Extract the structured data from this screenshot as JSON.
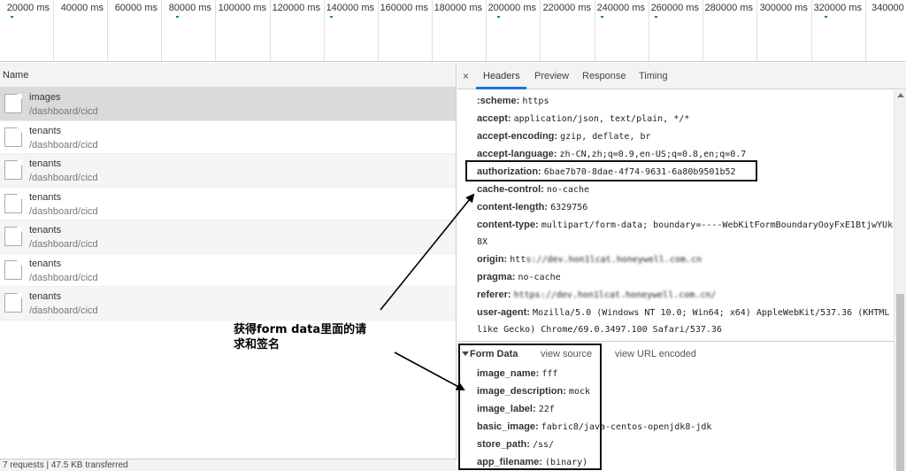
{
  "timeline": {
    "ticks": [
      "20000 ms",
      "40000 ms",
      "60000 ms",
      "80000 ms",
      "100000 ms",
      "120000 ms",
      "140000 ms",
      "160000 ms",
      "180000 ms",
      "200000 ms",
      "220000 ms",
      "240000 ms",
      "260000 ms",
      "280000 ms",
      "300000 ms",
      "320000 ms",
      "340000"
    ]
  },
  "requests": {
    "column_header": "Name",
    "items": [
      {
        "name": "images",
        "path": "/dashboard/cicd"
      },
      {
        "name": "tenants",
        "path": "/dashboard/cicd"
      },
      {
        "name": "tenants",
        "path": "/dashboard/cicd"
      },
      {
        "name": "tenants",
        "path": "/dashboard/cicd"
      },
      {
        "name": "tenants",
        "path": "/dashboard/cicd"
      },
      {
        "name": "tenants",
        "path": "/dashboard/cicd"
      },
      {
        "name": "tenants",
        "path": "/dashboard/cicd"
      }
    ],
    "status": "7 requests | 47.5 KB transferred"
  },
  "tabs": {
    "close": "×",
    "headers": "Headers",
    "preview": "Preview",
    "response": "Response",
    "timing": "Timing"
  },
  "headers": {
    "scheme": {
      "k": ":scheme:",
      "v": "https"
    },
    "accept": {
      "k": "accept:",
      "v": "application/json, text/plain, */*"
    },
    "accept_encoding": {
      "k": "accept-encoding:",
      "v": "gzip, deflate, br"
    },
    "accept_language": {
      "k": "accept-language:",
      "v": "zh-CN,zh;q=0.9,en-US;q=0.8,en;q=0.7"
    },
    "authorization": {
      "k": "authorization:",
      "v": "6bae7b70-8dae-4f74-9631-6a80b9501b52"
    },
    "cache_control": {
      "k": "cache-control:",
      "v": "no-cache"
    },
    "content_length": {
      "k": "content-length:",
      "v": "6329756"
    },
    "content_type": {
      "k": "content-type:",
      "v": "multipart/form-data; boundary=----WebKitFormBoundaryOoyFxE1BtjwYUk",
      "v2": "8X"
    },
    "origin": {
      "k": "origin:",
      "v": "htt"
    },
    "pragma": {
      "k": "pragma:",
      "v": "no-cache"
    },
    "referer": {
      "k": "referer:"
    },
    "user_agent": {
      "k": "user-agent:",
      "v": "Mozilla/5.0 (Windows NT 10.0; Win64; x64) AppleWebKit/537.36 (KHTML",
      "v2": "like Gecko) Chrome/69.0.3497.100 Safari/537.36"
    }
  },
  "form_data": {
    "title": "Form Data",
    "view_source": "view source",
    "view_url_encoded": "view URL encoded",
    "fields": [
      {
        "k": "image_name:",
        "v": "fff"
      },
      {
        "k": "image_description:",
        "v": "mock"
      },
      {
        "k": "image_label:",
        "v": "22f"
      },
      {
        "k": "basic_image:",
        "v": "fabric8/java-centos-openjdk8-jdk"
      },
      {
        "k": "store_path:",
        "v": "/ss/"
      },
      {
        "k": "app_filename:",
        "v": "(binary)"
      }
    ]
  },
  "annotation": {
    "line1": "获得form data里面的请",
    "line2": "求和签名"
  },
  "colors": {
    "accent_tab": "#1a73e8",
    "timeline_mark": "#0a8a7b",
    "selected_row": "#dadada"
  }
}
